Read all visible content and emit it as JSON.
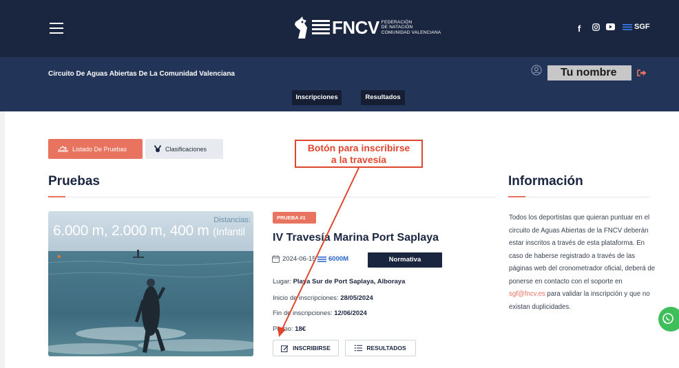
{
  "header": {
    "logo": {
      "wordmark": "FNCV",
      "sub_line1": "FEDERACIÓN",
      "sub_line2": "DE NATACIÓN",
      "sub_line3": "COMUNIDAD VALENCIANA"
    },
    "social": {
      "facebook": "f",
      "sgf_label": "SGF"
    },
    "icons": [
      "menu-icon",
      "facebook-icon",
      "instagram-icon",
      "youtube-icon",
      "sgf-lines-icon"
    ]
  },
  "subheader": {
    "circuit_title": "Circuito De Aguas Abiertas De La Comunidad Valenciana",
    "user_name": "Tu nombre",
    "nav": {
      "inscripciones": "Inscripciones",
      "resultados": "Resultados"
    }
  },
  "tabs": {
    "listado": "Listado De Pruebas",
    "clasificaciones": "Clasificaciones"
  },
  "annotation": {
    "line1": "Botón para inscribirse",
    "line2": "a la travesía",
    "color": "#e0452e"
  },
  "pruebas": {
    "heading": "Pruebas",
    "card": {
      "image_caption_label": "Distancias:",
      "image_caption_main": "6.000 m, 2.000 m, 400 m",
      "image_caption_small": "(Infantil",
      "badge": "PRUEBA #1",
      "title": "IV Travesía Marina Port Saplaya",
      "date": "2024-06-15",
      "distance": "6000M",
      "normativa": "Normativa",
      "lugar_label": "Lugar: ",
      "lugar_value": "Playa Sur de Port Saplaya, Alboraya",
      "inicio_label": "Inicio de inscripciones: ",
      "inicio_value": "28/05/2024",
      "fin_label": "Fin de inscripciones: ",
      "fin_value": "12/06/2024",
      "precio_label": "Precio: ",
      "precio_value": "18€",
      "btn_inscribirse": "INSCRIBIRSE",
      "btn_resultados": "RESULTADOS"
    }
  },
  "informacion": {
    "heading": "Información",
    "text_before": "Todos los deportistas que quieran puntuar en el circuito de Aguas Abiertas de la FNCV deberán estar inscritos a través de esta plataforma. En caso de haberse registrado a través de las páginas web del cronometrador oficial, deberá de ponerse en contacto con el soporte en ",
    "email": "sgf@fncv.es",
    "text_after": " para validar la inscripción y que no existan duplicidades."
  },
  "colors": {
    "navy": "#1a2540",
    "navy_sub": "#223458",
    "accent": "#e8735f",
    "link_blue": "#2563c9",
    "whatsapp_green": "#3fbf5c"
  }
}
